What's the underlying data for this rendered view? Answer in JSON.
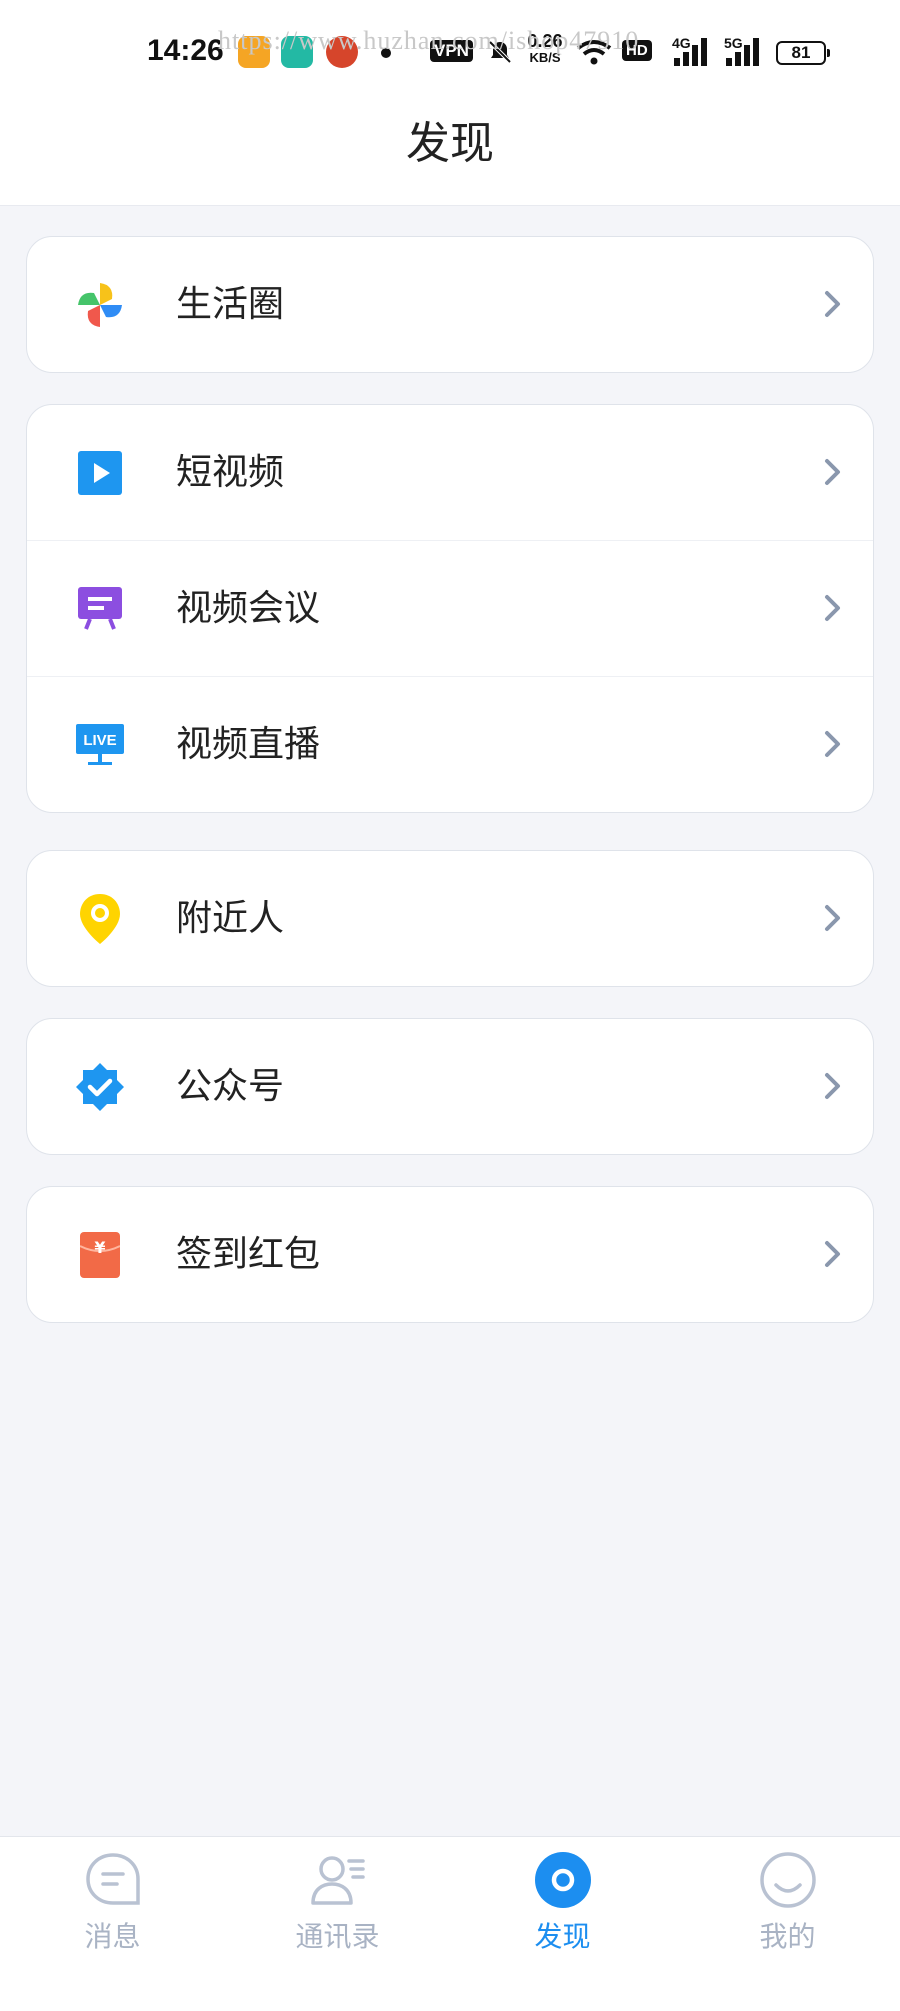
{
  "status_bar": {
    "time": "14:26",
    "watermark": "https://www.huzhan.com/ishop47910",
    "vpn": "VPN",
    "speed_value": "0.26",
    "speed_unit": "KB/S",
    "hd": "HD",
    "net1": "4G",
    "net2": "5G",
    "battery": "81"
  },
  "header": {
    "title": "发现"
  },
  "cards": [
    {
      "items": [
        {
          "label": "生活圈",
          "icon": "pinwheel-icon"
        }
      ]
    },
    {
      "items": [
        {
          "label": "短视频",
          "icon": "play-video-icon",
          "color": "#1e96f0"
        },
        {
          "label": "视频会议",
          "icon": "meeting-board-icon",
          "color": "#8c4ee0"
        },
        {
          "label": "视频直播",
          "icon": "live-screen-icon",
          "live_text": "LIVE",
          "color": "#1e96f0"
        }
      ]
    },
    {
      "items": [
        {
          "label": "附近人",
          "icon": "location-pin-icon",
          "color": "#ffd400"
        }
      ]
    },
    {
      "items": [
        {
          "label": "公众号",
          "icon": "verified-badge-icon",
          "color": "#1e96f0"
        }
      ]
    },
    {
      "items": [
        {
          "label": "签到红包",
          "icon": "red-envelope-icon",
          "symbol": "¥",
          "color": "#f26a47"
        }
      ]
    }
  ],
  "tabbar": {
    "tabs": [
      {
        "label": "消息",
        "icon": "message-bubble-icon",
        "active": false
      },
      {
        "label": "通讯录",
        "icon": "contacts-icon",
        "active": false
      },
      {
        "label": "发现",
        "icon": "discover-icon",
        "active": true
      },
      {
        "label": "我的",
        "icon": "smiley-profile-icon",
        "active": false
      }
    ],
    "colors": {
      "active": "#1c8ef0",
      "inactive": "#a9b3c4"
    }
  }
}
